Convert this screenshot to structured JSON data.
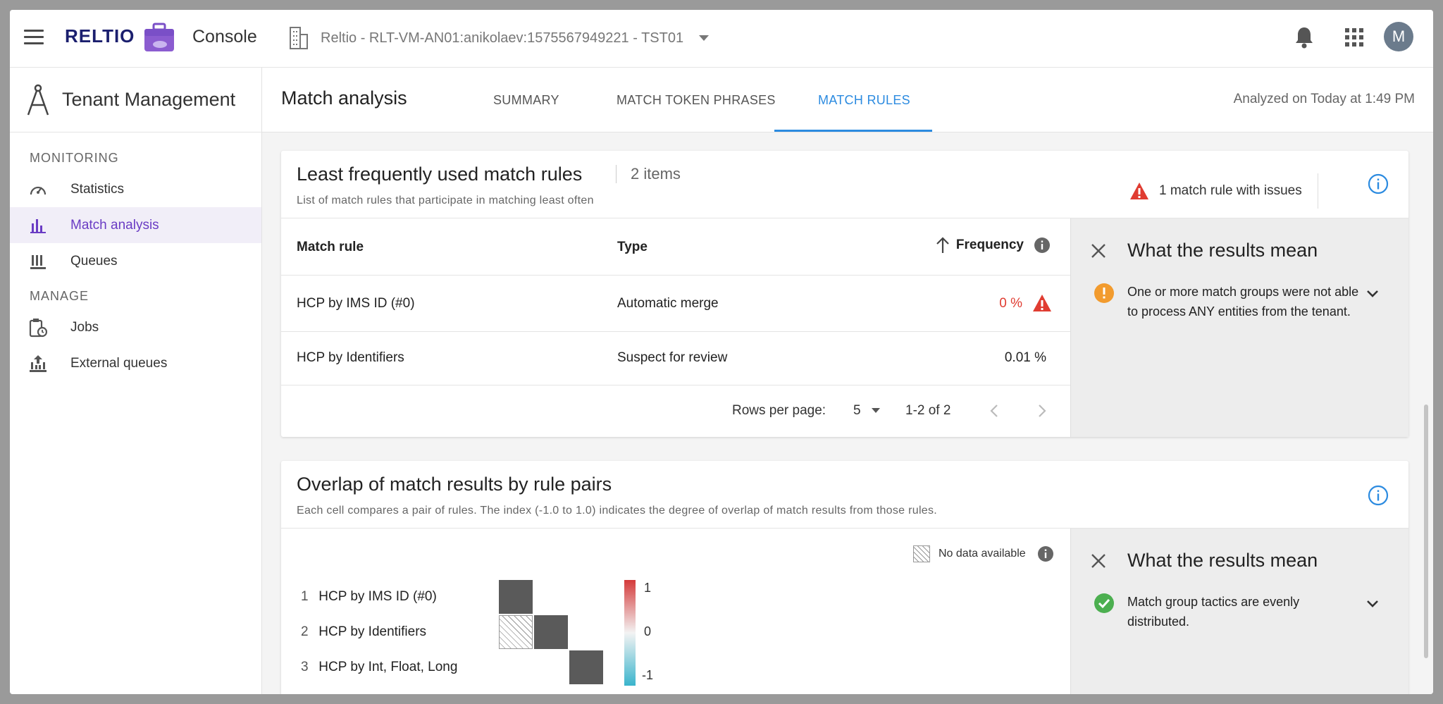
{
  "app": {
    "brand": "RELTIO",
    "product": "Console",
    "tenant": "Reltio - RLT-VM-AN01:anikolaev:1575567949221 - TST01",
    "avatar_initial": "M"
  },
  "sidebar": {
    "title": "Tenant Management",
    "sections": [
      {
        "label": "MONITORING",
        "items": [
          {
            "label": "Statistics",
            "icon": "gauge-icon"
          },
          {
            "label": "Match analysis",
            "icon": "bar-chart-icon",
            "active": true
          },
          {
            "label": "Queues",
            "icon": "queues-icon"
          }
        ]
      },
      {
        "label": "MANAGE",
        "items": [
          {
            "label": "Jobs",
            "icon": "clipboard-clock-icon"
          },
          {
            "label": "External queues",
            "icon": "upload-queue-icon"
          }
        ]
      }
    ]
  },
  "header": {
    "title": "Match analysis",
    "tabs": [
      {
        "label": "SUMMARY"
      },
      {
        "label": "MATCH TOKEN PHRASES"
      },
      {
        "label": "MATCH RULES",
        "active": true
      }
    ],
    "analyzed": "Analyzed on Today at 1:49 PM"
  },
  "least_used": {
    "title": "Least frequently used match rules",
    "count": "2 items",
    "subtitle": "List of match rules that participate in matching least often",
    "issues": "1 match rule with issues",
    "columns": {
      "rule": "Match rule",
      "type": "Type",
      "frequency": "Frequency"
    },
    "rows": [
      {
        "rule": "HCP by IMS ID (#0)",
        "type": "Automatic merge",
        "frequency": "0 %",
        "warning": true
      },
      {
        "rule": "HCP by Identifiers",
        "type": "Suspect for review",
        "frequency": "0.01 %",
        "warning": false
      }
    ],
    "pager": {
      "rows_label": "Rows per page:",
      "rows_value": "5",
      "range": "1-2 of 2"
    },
    "panel": {
      "title": "What the results mean",
      "text": "One or more match groups were not able to process ANY entities from the tenant.",
      "status_color": "#f29b2e"
    }
  },
  "overlap": {
    "title": "Overlap of match results by rule pairs",
    "subtitle": "Each cell compares a pair of rules. The index (-1.0 to 1.0) indicates the degree of overlap of match results from those rules.",
    "legend": "No data available",
    "rules": [
      {
        "n": "1",
        "label": "HCP by IMS ID (#0)"
      },
      {
        "n": "2",
        "label": "HCP by Identifiers"
      },
      {
        "n": "3",
        "label": "HCP by Int, Float, Long"
      }
    ],
    "scale": {
      "max": "1",
      "mid": "0",
      "min": "-1"
    },
    "panel": {
      "title": "What the results mean",
      "text": "Match group tactics are evenly distributed.",
      "status_color": "#4caf50"
    }
  }
}
